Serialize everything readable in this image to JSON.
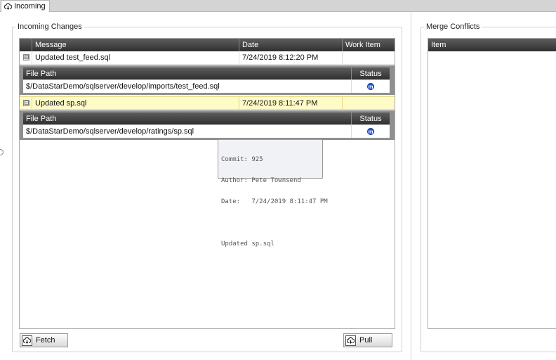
{
  "tab": {
    "label": "Incoming"
  },
  "incoming": {
    "group_label": "Incoming Changes",
    "columns": {
      "message": "Message",
      "date": "Date",
      "work_item": "Work Item"
    },
    "commits": [
      {
        "message": "Updated test_feed.sql",
        "date": "7/24/2019 8:12:20 PM",
        "work_item": "",
        "expander": "⊟",
        "files_header": {
          "path": "File Path",
          "status": "Status"
        },
        "files": [
          {
            "path": "$/DataStarDemo/sqlserver/develop/imports/test_feed.sql",
            "status": "m"
          }
        ]
      },
      {
        "message": "Updated sp.sql",
        "date": "7/24/2019 8:11:47 PM",
        "work_item": "",
        "expander": "⊟",
        "files_header": {
          "path": "File Path",
          "status": "Status"
        },
        "files": [
          {
            "path": "$/DataStarDemo/sqlserver/develop/ratings/sp.sql",
            "status": "m"
          }
        ]
      }
    ],
    "tooltip": {
      "commit": "Commit: 925",
      "author": "Author: Pete Townsend",
      "date": "Date:   7/24/2019 8:11:47 PM",
      "message": "Updated sp.sql"
    },
    "fetch_button": "Fetch",
    "pull_button": "Pull"
  },
  "merge": {
    "group_label": "Merge Conflicts",
    "columns": {
      "item": "Item"
    }
  },
  "colors": {
    "header_dark": "#2f2f2f",
    "highlight_row": "#fffbc6",
    "status_icon": "#1f55d6"
  },
  "icons": {
    "tab": "cloud-download-icon",
    "status": "modified-status-icon",
    "fetch": "cloud-download-icon",
    "pull": "cloud-download-icon"
  }
}
